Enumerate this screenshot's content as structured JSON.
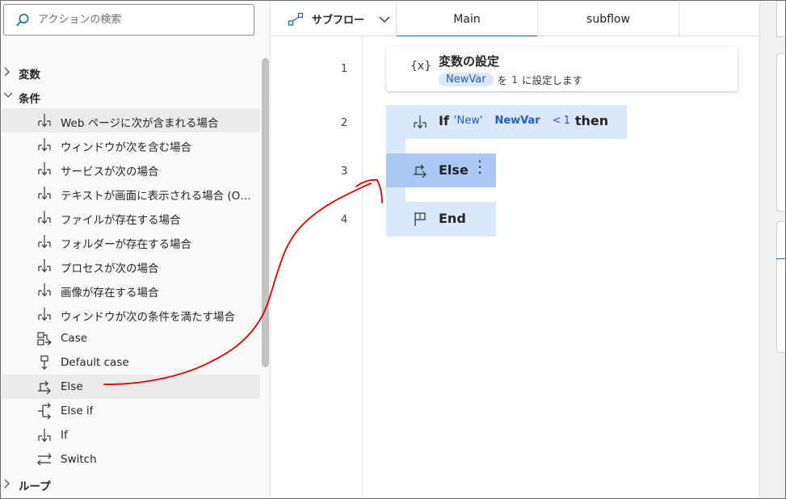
{
  "search": {
    "placeholder": "アクションの検索"
  },
  "actions_panel": {
    "group_variables": "変数",
    "group_conditions": "条件",
    "group_loops": "ループ",
    "items": [
      {
        "label": "Web ページに次が含まれる場合",
        "icon": "branch-down-icon"
      },
      {
        "label": "ウィンドウが次を含む場合",
        "icon": "branch-down-icon"
      },
      {
        "label": "サービスが次の場合",
        "icon": "branch-down-icon"
      },
      {
        "label": "テキストが画面に表示される場合 (OC...",
        "icon": "branch-down-icon"
      },
      {
        "label": "ファイルが存在する場合",
        "icon": "branch-down-icon"
      },
      {
        "label": "フォルダーが存在する場合",
        "icon": "branch-down-icon"
      },
      {
        "label": "プロセスが次の場合",
        "icon": "branch-down-icon"
      },
      {
        "label": "画像が存在する場合",
        "icon": "branch-down-icon"
      },
      {
        "label": "ウィンドウが次の条件を満たす場合",
        "icon": "branch-down-icon"
      },
      {
        "label": "Case",
        "icon": "case-icon"
      },
      {
        "label": "Default case",
        "icon": "default-case-icon"
      },
      {
        "label": "Else",
        "icon": "else-icon"
      },
      {
        "label": "Else if",
        "icon": "else-if-icon"
      },
      {
        "label": "If",
        "icon": "branch-down-icon"
      },
      {
        "label": "Switch",
        "icon": "switch-icon"
      }
    ]
  },
  "tabs": {
    "subflow_menu": "サブフロー",
    "main": "Main",
    "subflow": "subflow"
  },
  "flow": {
    "line_numbers": [
      "1",
      "2",
      "3",
      "4"
    ],
    "step1": {
      "icon_text": "{x}",
      "title": "変数の設定",
      "var": "NewVar",
      "text_a": "を",
      "value": "1",
      "text_b": "に設定します"
    },
    "if_step": {
      "keyword": "If",
      "string": "'New'",
      "var": "NewVar",
      "op": "<",
      "value": "1",
      "then": "then"
    },
    "else_step": {
      "keyword": "Else",
      "menu": "⋮"
    },
    "end_step": {
      "keyword": "End"
    }
  },
  "colors": {
    "accent": "#1b67c9",
    "block": "#dae8fb",
    "block_selected": "#a9c8f5",
    "annotation": "#e00000"
  }
}
